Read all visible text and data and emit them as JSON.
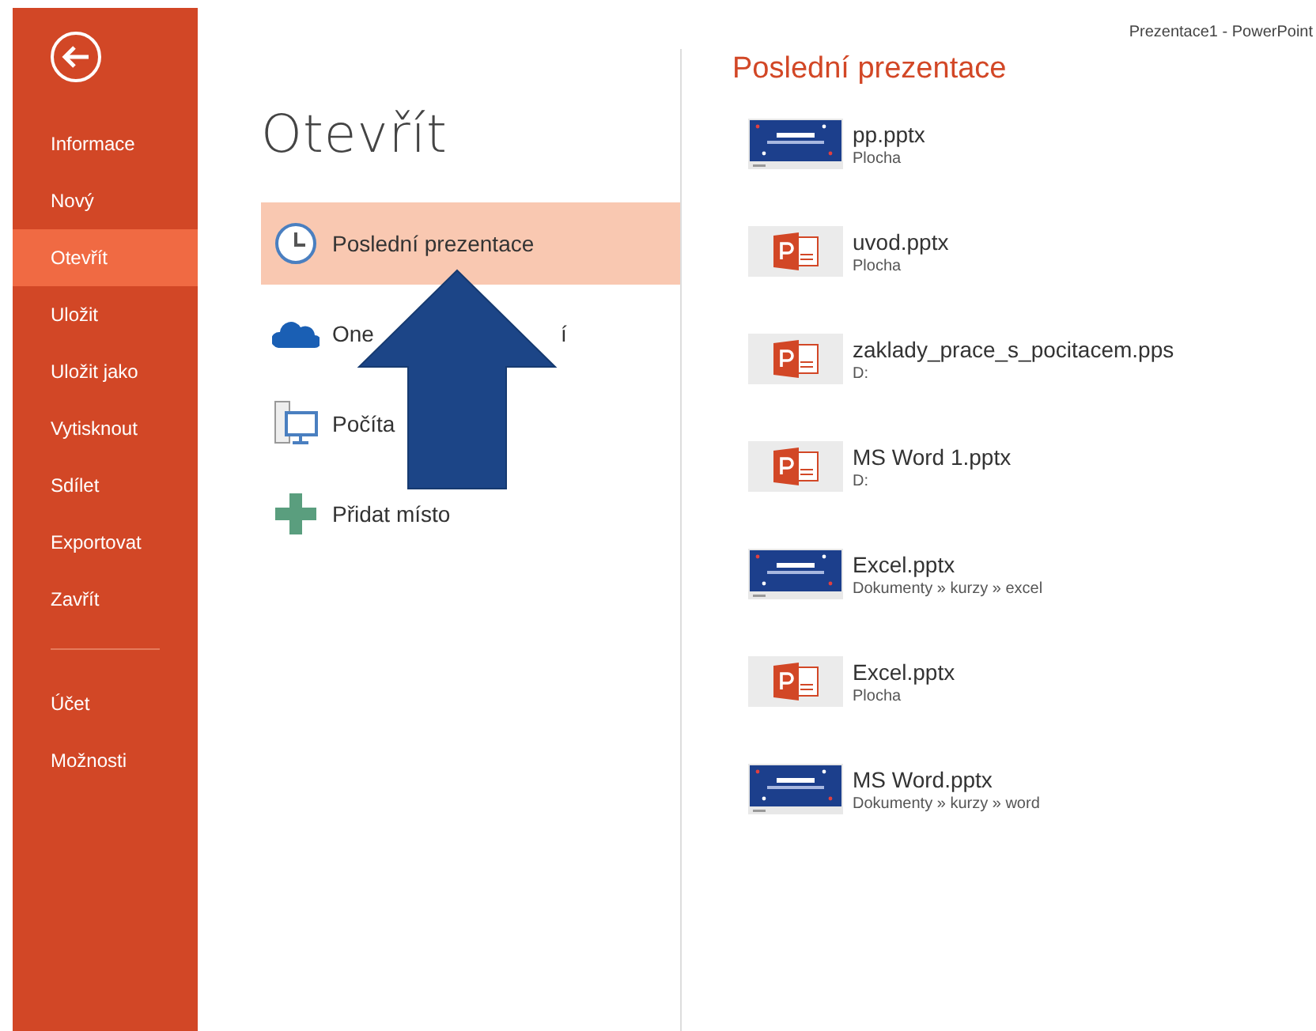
{
  "window": {
    "title": "Prezentace1 - PowerPoint"
  },
  "sidebar": {
    "items": [
      {
        "label": "Informace",
        "selected": false
      },
      {
        "label": "Nový",
        "selected": false
      },
      {
        "label": "Otevřít",
        "selected": true
      },
      {
        "label": "Uložit",
        "selected": false
      },
      {
        "label": "Uložit jako",
        "selected": false
      },
      {
        "label": "Vytisknout",
        "selected": false
      },
      {
        "label": "Sdílet",
        "selected": false
      },
      {
        "label": "Exportovat",
        "selected": false
      },
      {
        "label": "Zavřít",
        "selected": false
      },
      {
        "kind": "divider"
      },
      {
        "label": "Účet",
        "selected": false
      },
      {
        "label": "Možnosti",
        "selected": false
      }
    ]
  },
  "heading": "Otevřít",
  "places": [
    {
      "kind": "recent",
      "label": "Poslední prezentace",
      "selected": true
    },
    {
      "kind": "cloud",
      "label": "One",
      "label_tail": "í",
      "selected": false
    },
    {
      "kind": "computer",
      "label": "Počíta",
      "selected": false
    },
    {
      "kind": "add",
      "label": "Přidat místo",
      "selected": false
    }
  ],
  "recent": {
    "title": "Poslední prezentace",
    "files": [
      {
        "kind": "slide",
        "name": "pp.pptx",
        "location": "Plocha"
      },
      {
        "kind": "pptx",
        "name": "uvod.pptx",
        "location": "Plocha"
      },
      {
        "kind": "pptx",
        "name": "zaklady_prace_s_pocitacem.pps",
        "location": "D:"
      },
      {
        "kind": "pptx",
        "name": "MS Word 1.pptx",
        "location": "D:"
      },
      {
        "kind": "slide",
        "name": "Excel.pptx",
        "location": "Dokumenty » kurzy » excel"
      },
      {
        "kind": "pptx",
        "name": "Excel.pptx",
        "location": "Plocha"
      },
      {
        "kind": "slide",
        "name": "MS Word.pptx",
        "location": "Dokumenty » kurzy » word"
      }
    ]
  }
}
